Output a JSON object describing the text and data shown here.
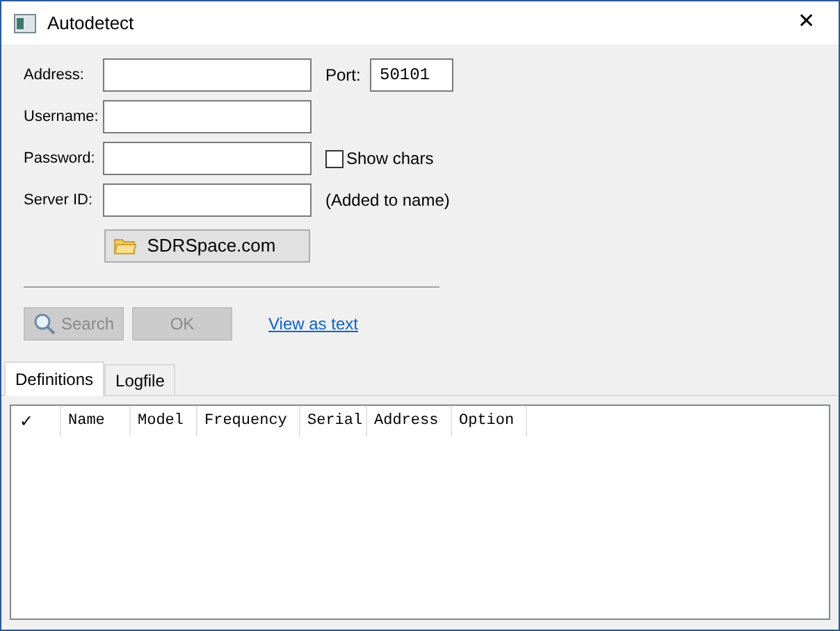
{
  "window": {
    "title": "Autodetect",
    "close": "✕"
  },
  "fields": [
    {
      "label": "Address:"
    },
    {
      "label": "Username:"
    },
    {
      "label": "Password:"
    },
    {
      "label": "Server ID:"
    }
  ],
  "port": {
    "label": "Port:",
    "value": "50101"
  },
  "show_chars": {
    "label": "Show chars",
    "checked": false
  },
  "server_id_note": "(Added to name)",
  "site_button": "SDRSpace.com",
  "buttons": [
    {
      "label": "Search",
      "disabled": true,
      "kind": "search"
    },
    {
      "label": "OK",
      "disabled": true,
      "kind": "plain"
    }
  ],
  "link": "View as text",
  "tabs": [
    {
      "label": "Definitions",
      "selected": true
    },
    {
      "label": "Logfile",
      "selected": false
    }
  ],
  "table": {
    "columns": [
      "✓",
      "Name",
      "Model",
      "Frequency",
      "Serial",
      "Address",
      "Option"
    ]
  }
}
